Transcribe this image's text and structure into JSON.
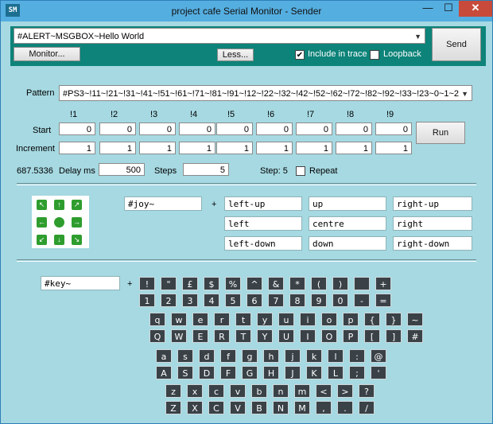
{
  "window": {
    "title": "project cafe Serial Monitor - Sender",
    "icon": "SM",
    "minimize": "—",
    "maximize": "☐",
    "close": "✕"
  },
  "send": {
    "message": "#ALERT~MSGBOX~Hello World",
    "button": "Send",
    "monitor_button": "Monitor...",
    "less_button": "Less...",
    "include_trace_label": "Include in trace",
    "include_trace_checked": true,
    "loopback_label": "Loopback",
    "loopback_checked": false
  },
  "pattern": {
    "label": "Pattern",
    "value": "#PS3~!11~!21~!31~!41~!51~!61~!71~!81~!91~!12~!22~!32~!42~!52~!62~!72~!82~!92~!33~!23~0~1~2",
    "headers": [
      "!1",
      "!2",
      "!3",
      "!4",
      "!5",
      "!6",
      "!7",
      "!8",
      "!9"
    ],
    "start_label": "Start",
    "increment_label": "Increment",
    "start_values": [
      "0",
      "0",
      "0",
      "0",
      "0",
      "0",
      "0",
      "0",
      "0"
    ],
    "increment_values": [
      "1",
      "1",
      "1",
      "1",
      "1",
      "1",
      "1",
      "1",
      "1"
    ],
    "run_button": "Run",
    "timer": "687.5336",
    "delay_label": "Delay ms",
    "delay_value": "500",
    "steps_label": "Steps",
    "steps_value": "5",
    "step_status": "Step: 5",
    "repeat_label": "Repeat",
    "repeat_checked": false
  },
  "joystick": {
    "prefix": "#joy~",
    "plus": "+",
    "pad_icons": [
      "arrow-up-left-icon",
      "arrow-up-icon",
      "arrow-up-right-icon",
      "arrow-left-icon",
      "centre-dot-icon",
      "arrow-right-icon",
      "arrow-down-left-icon",
      "arrow-down-icon",
      "arrow-down-right-icon"
    ],
    "pad_glyphs": [
      "↖",
      "↑",
      "↗",
      "←",
      "",
      "→",
      "↙",
      "↓",
      "↘"
    ],
    "directions": [
      "left-up",
      "up",
      "right-up",
      "left",
      "centre",
      "right",
      "left-down",
      "down",
      "right-down"
    ]
  },
  "keyboard": {
    "prefix": "#key~",
    "plus": "+",
    "row1_top": [
      "!",
      "\"",
      "£",
      "$",
      "%",
      "^",
      "&",
      "*",
      "(",
      ")",
      "",
      "+"
    ],
    "row1_bottom": [
      "1",
      "2",
      "3",
      "4",
      "5",
      "6",
      "7",
      "8",
      "9",
      "0",
      "-",
      "="
    ],
    "row2_top": [
      "q",
      "w",
      "e",
      "r",
      "t",
      "y",
      "u",
      "i",
      "o",
      "p",
      "{",
      "}",
      "~"
    ],
    "row2_bottom": [
      "Q",
      "W",
      "E",
      "R",
      "T",
      "Y",
      "U",
      "I",
      "O",
      "P",
      "[",
      "]",
      "#"
    ],
    "row3_top": [
      "a",
      "s",
      "d",
      "f",
      "g",
      "h",
      "j",
      "k",
      "l",
      ":",
      "@"
    ],
    "row3_bottom": [
      "A",
      "S",
      "D",
      "F",
      "G",
      "H",
      "J",
      "K",
      "L",
      ";",
      "'"
    ],
    "row4_top": [
      "z",
      "x",
      "c",
      "v",
      "b",
      "n",
      "m",
      "<",
      ">",
      "?"
    ],
    "row4_bottom": [
      "Z",
      "X",
      "C",
      "V",
      "B",
      "N",
      "M",
      ",",
      ".",
      "/"
    ]
  }
}
